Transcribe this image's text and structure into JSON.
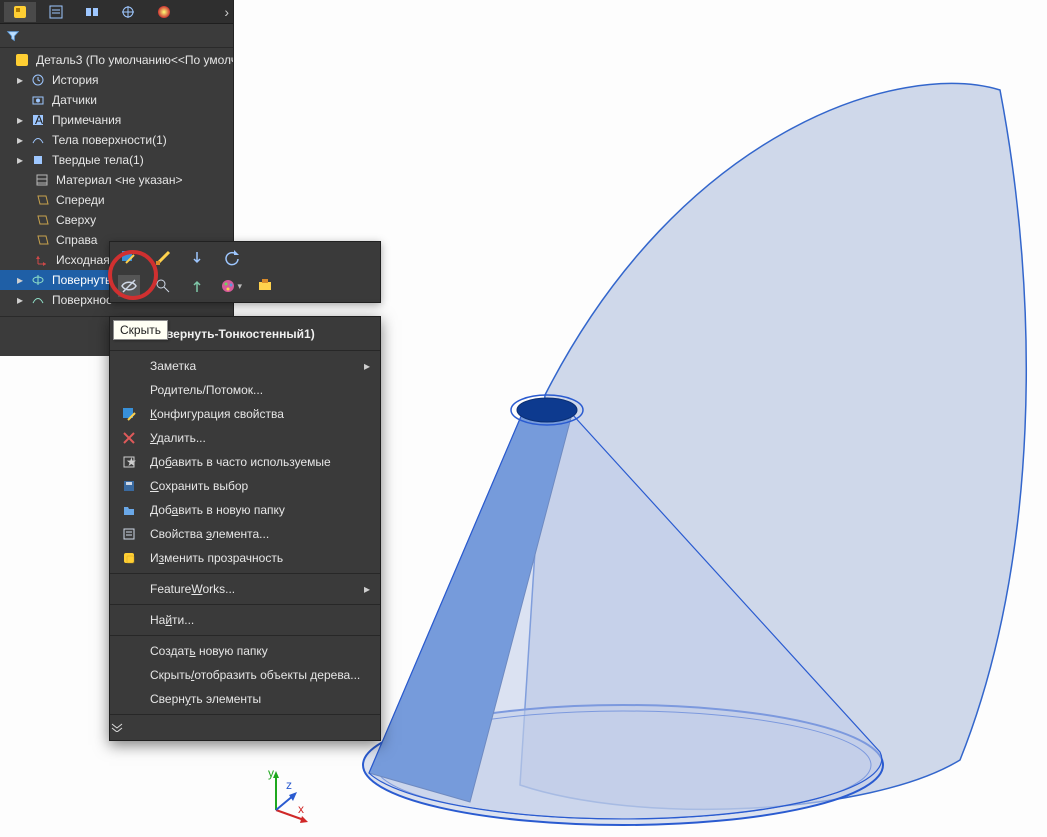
{
  "tree": {
    "root_label": "Деталь3  (По умолчанию<<По умолч",
    "items": [
      {
        "label": "История"
      },
      {
        "label": "Датчики"
      },
      {
        "label": "Примечания"
      },
      {
        "label": "Тела поверхности(1)"
      },
      {
        "label": "Твердые тела(1)"
      },
      {
        "label": "Материал <не указан>"
      },
      {
        "label": "Спереди"
      },
      {
        "label": "Сверху"
      },
      {
        "label": "Справа"
      },
      {
        "label": "Исходная т"
      },
      {
        "label": "Повернуть-"
      },
      {
        "label": "Поверхнос"
      }
    ]
  },
  "tooltip": {
    "text": "Скрыть"
  },
  "menu": {
    "title": "Повернуть-Тонкостенный1)",
    "items": [
      {
        "label": "Заметка",
        "submenu": true
      },
      {
        "label": "Родитель/Потомок..."
      },
      {
        "label": "Конфигурация свойства",
        "icon": "config"
      },
      {
        "label": "Удалить...",
        "icon": "delete"
      },
      {
        "label": "Добавить в часто используемые",
        "icon": "favorite"
      },
      {
        "label": "Сохранить выбор",
        "icon": "save"
      },
      {
        "label": "Добавить в новую папку",
        "icon": "folder"
      },
      {
        "label": "Свойства элемента...",
        "icon": "props"
      },
      {
        "label": "Изменить прозрачность",
        "icon": "transparency"
      },
      {
        "label": "FeatureWorks...",
        "submenu": true
      },
      {
        "label": "Найти..."
      },
      {
        "label": "Создать новую папку"
      },
      {
        "label": "Скрыть/отобразить объекты дерева..."
      },
      {
        "label": "Свернуть элементы"
      }
    ],
    "labels_html": {
      "2": "<span class='underline-char'>К</span>онфигурация свойства",
      "3": "<span class='underline-char'>У</span>далить...",
      "4": "До<span class='underline-char'>б</span>авить в часто используемые",
      "5": "<span class='underline-char'>С</span>охранить выбор",
      "6": "Доб<span class='underline-char'>а</span>вить в новую папку",
      "7": "Свойства <span class='underline-char'>э</span>лемента...",
      "8": "И<span class='underline-char'>з</span>менить прозрачность",
      "9": "Feature<span class='underline-char'>W</span>orks...",
      "10": "На<span class='underline-char'>й</span>ти...",
      "11": "Создат<span class='underline-char'>ь</span> новую папку",
      "12": "Скрыть<span class='underline-char'>/</span>отобразить объекты дерева...",
      "13": "Сверн<span class='underline-char'>у</span>ть элементы"
    }
  },
  "triad": {
    "x": "x",
    "y": "y",
    "z": "z"
  }
}
